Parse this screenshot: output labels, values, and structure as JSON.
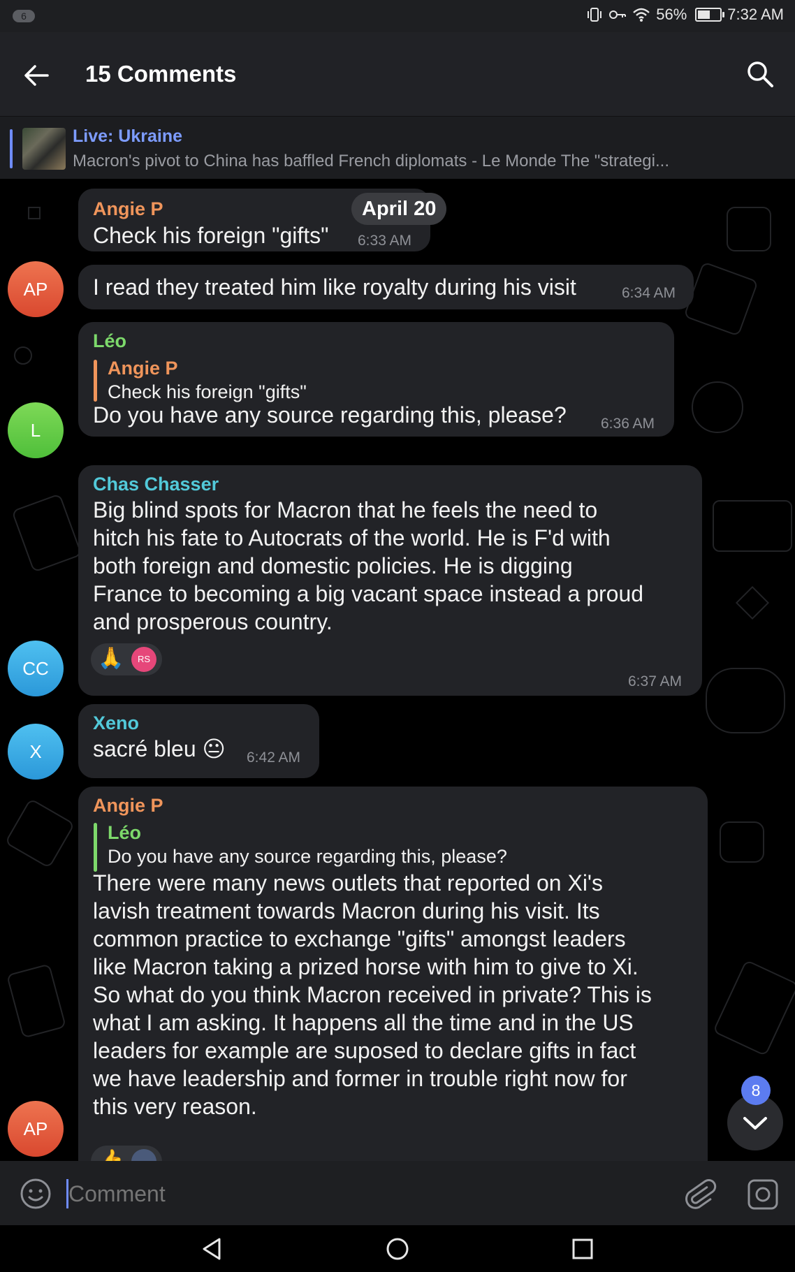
{
  "status_bar": {
    "notification_count": "6",
    "battery_percent": "56%",
    "battery_level": 0.56,
    "time": "7:32 AM"
  },
  "header": {
    "title": "15 Comments"
  },
  "pinned": {
    "title": "Live: Ukraine",
    "text": "Macron's pivot to China has baffled French diplomats - Le Monde  The \"strategi..."
  },
  "date_divider": "April 20",
  "messages": [
    {
      "sender": "Angie P",
      "text": "Check his foreign \"gifts\"",
      "time": "6:33 AM"
    },
    {
      "text": "I read they treated him like royalty during his visit",
      "time": "6:34 AM"
    },
    {
      "sender": "Léo",
      "reply_to": {
        "sender": "Angie P",
        "text": "Check his foreign \"gifts\""
      },
      "text": "Do you have any source regarding this, please?",
      "time": "6:36 AM"
    },
    {
      "sender": "Chas Chasser",
      "lines": [
        "Big blind spots for Macron that he feels the need to",
        "hitch his fate to Autocrats of the world.  He is F'd with",
        "both foreign and domestic policies.   He is digging",
        "France to becoming a big vacant space instead a proud",
        "and prosperous country."
      ],
      "reaction": {
        "emoji": "🙏",
        "user": "RS"
      },
      "time": "6:37 AM"
    },
    {
      "sender": "Xeno",
      "text": "sacré bleu 😐",
      "time": "6:42 AM"
    },
    {
      "sender": "Angie P",
      "reply_to": {
        "sender": "Léo",
        "text": "Do you have any source regarding this, please?"
      },
      "lines": [
        "There were many news outlets that reported on Xi's",
        "lavish treatment towards Macron during his visit. Its",
        "common practice to exchange \"gifts\" amongst leaders",
        "like Macron taking a prized horse with him to give to Xi.",
        "So what do you think Macron received in private? This is",
        "what I am asking. It happens all the time and in the US",
        "leaders for example are suposed to declare gifts in fact",
        "we have leadership and former in trouble right now for",
        "this very reason."
      ],
      "reaction": {
        "emoji": "👍"
      }
    }
  ],
  "avatars": {
    "angie": "AP",
    "leo": "L",
    "chas": "CC",
    "xeno": "X"
  },
  "unread_count": "8",
  "input": {
    "placeholder": "Comment"
  },
  "colors": {
    "angie": "#f0955b",
    "leo": "#7dd96b",
    "chas": "#52c9d9",
    "xeno": "#52c9d9",
    "accent": "#6f8cff"
  }
}
